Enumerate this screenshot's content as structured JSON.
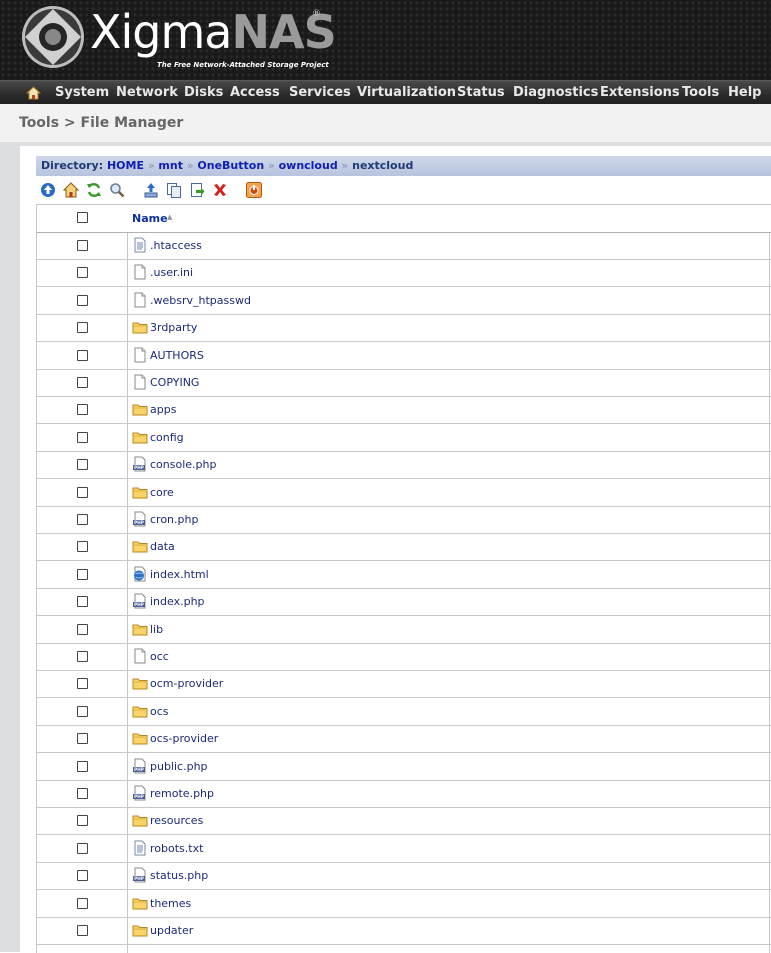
{
  "header": {
    "logo_text_a": "Xigma",
    "logo_text_b": "NAS",
    "logo_reg": "®",
    "tagline": "The Free Network-Attached Storage Project"
  },
  "nav": {
    "home_icon": "home-icon",
    "items": [
      "System",
      "Network",
      "Disks",
      "Access",
      "Services",
      "Virtualization",
      "Status",
      "Diagnostics",
      "Extensions",
      "Tools",
      "Help"
    ]
  },
  "page": {
    "title": "Tools > File Manager"
  },
  "directory": {
    "label": "Directory:",
    "path": [
      "HOME",
      "mnt",
      "OneButton",
      "owncloud",
      "nextcloud"
    ],
    "separator": "»"
  },
  "toolbar": {
    "icons": [
      "up-icon",
      "home-icon",
      "refresh-icon",
      "search-icon",
      "upload-icon",
      "copy-icon",
      "move-icon",
      "delete-icon",
      "logout-icon"
    ]
  },
  "table": {
    "name_header": "Name",
    "sort_indicator": "▲",
    "rows": [
      {
        "name": ".htaccess",
        "icon": "text-file-icon"
      },
      {
        "name": ".user.ini",
        "icon": "blank-file-icon"
      },
      {
        "name": ".websrv_htpasswd",
        "icon": "blank-file-icon"
      },
      {
        "name": "3rdparty",
        "icon": "folder-icon"
      },
      {
        "name": "AUTHORS",
        "icon": "blank-file-icon"
      },
      {
        "name": "COPYING",
        "icon": "blank-file-icon"
      },
      {
        "name": "apps",
        "icon": "folder-icon"
      },
      {
        "name": "config",
        "icon": "folder-icon"
      },
      {
        "name": "console.php",
        "icon": "php-file-icon"
      },
      {
        "name": "core",
        "icon": "folder-icon"
      },
      {
        "name": "cron.php",
        "icon": "php-file-icon"
      },
      {
        "name": "data",
        "icon": "folder-icon"
      },
      {
        "name": "index.html",
        "icon": "html-file-icon"
      },
      {
        "name": "index.php",
        "icon": "php-file-icon"
      },
      {
        "name": "lib",
        "icon": "folder-icon"
      },
      {
        "name": "occ",
        "icon": "blank-file-icon"
      },
      {
        "name": "ocm-provider",
        "icon": "folder-icon"
      },
      {
        "name": "ocs",
        "icon": "folder-icon"
      },
      {
        "name": "ocs-provider",
        "icon": "folder-icon"
      },
      {
        "name": "public.php",
        "icon": "php-file-icon"
      },
      {
        "name": "remote.php",
        "icon": "php-file-icon"
      },
      {
        "name": "resources",
        "icon": "folder-icon"
      },
      {
        "name": "robots.txt",
        "icon": "text-file-icon"
      },
      {
        "name": "status.php",
        "icon": "php-file-icon"
      },
      {
        "name": "themes",
        "icon": "folder-icon"
      },
      {
        "name": "updater",
        "icon": "folder-icon"
      }
    ]
  }
}
